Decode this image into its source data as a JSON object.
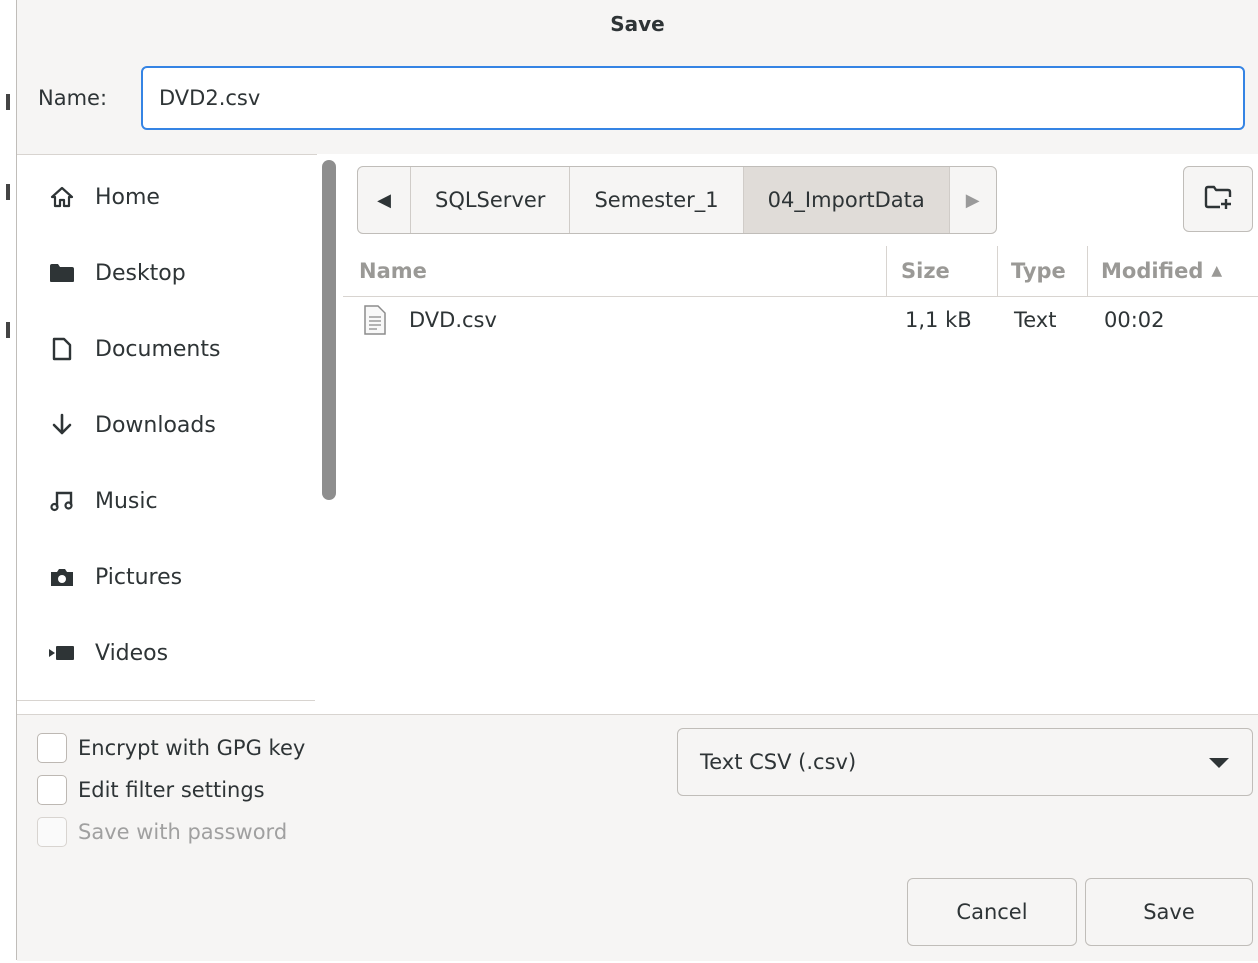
{
  "window": {
    "title": "Save"
  },
  "name_field": {
    "label": "Name:",
    "value": "DVD2.csv"
  },
  "sidebar": {
    "items": [
      {
        "label": "Home",
        "icon": "home-icon"
      },
      {
        "label": "Desktop",
        "icon": "folder-icon"
      },
      {
        "label": "Documents",
        "icon": "document-icon"
      },
      {
        "label": "Downloads",
        "icon": "download-icon"
      },
      {
        "label": "Music",
        "icon": "music-icon"
      },
      {
        "label": "Pictures",
        "icon": "camera-icon"
      },
      {
        "label": "Videos",
        "icon": "video-icon"
      }
    ]
  },
  "pathbar": {
    "segments": [
      "SQLServer",
      "Semester_1",
      "04_ImportData"
    ]
  },
  "file_list": {
    "columns": {
      "name": "Name",
      "size": "Size",
      "type": "Type",
      "modified": "Modified"
    },
    "rows": [
      {
        "name": "DVD.csv",
        "size": "1,1 kB",
        "type": "Text",
        "modified": "00:02"
      }
    ]
  },
  "options": {
    "encrypt": "Encrypt with GPG key",
    "edit_filter": "Edit filter settings",
    "save_password": "Save with password"
  },
  "filter": {
    "selected": "Text CSV (.csv)"
  },
  "buttons": {
    "cancel": "Cancel",
    "save": "Save"
  },
  "colors": {
    "accent": "#3584e4",
    "background": "#f6f5f4"
  }
}
